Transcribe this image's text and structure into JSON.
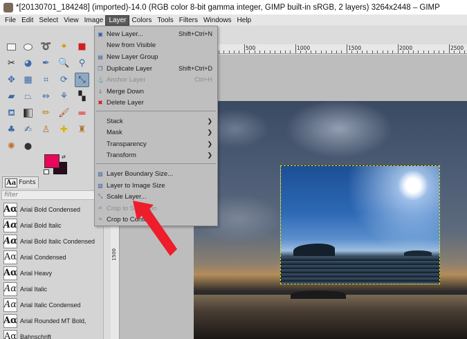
{
  "window": {
    "title": "*[20130701_184248] (imported)-14.0 (RGB color 8-bit gamma integer, GIMP built-in sRGB, 2 layers) 3264x2448 – GIMP"
  },
  "menubar": [
    {
      "label": "File"
    },
    {
      "label": "Edit"
    },
    {
      "label": "Select"
    },
    {
      "label": "View"
    },
    {
      "label": "Image"
    },
    {
      "label": "Layer",
      "active": true
    },
    {
      "label": "Colors"
    },
    {
      "label": "Tools"
    },
    {
      "label": "Filters"
    },
    {
      "label": "Windows"
    },
    {
      "label": "Help"
    }
  ],
  "layer_menu": {
    "items": [
      {
        "label": "New Layer...",
        "shortcut": "Shift+Ctrl+N",
        "icon": "new-layer-icon",
        "enabled": true
      },
      {
        "label": "New from Visible",
        "shortcut": "",
        "icon": "",
        "enabled": true
      },
      {
        "label": "New Layer Group",
        "shortcut": "",
        "icon": "layer-group-icon",
        "enabled": true
      },
      {
        "label": "Duplicate Layer",
        "shortcut": "Shift+Ctrl+D",
        "icon": "duplicate-icon",
        "enabled": true
      },
      {
        "label": "Anchor Layer",
        "shortcut": "Ctrl+H",
        "icon": "anchor-icon",
        "enabled": false
      },
      {
        "label": "Merge Down",
        "shortcut": "",
        "icon": "merge-icon",
        "enabled": true
      },
      {
        "label": "Delete Layer",
        "shortcut": "",
        "icon": "delete-icon",
        "enabled": true
      }
    ],
    "submenus": [
      {
        "label": "Stack"
      },
      {
        "label": "Mask"
      },
      {
        "label": "Transparency"
      },
      {
        "label": "Transform"
      }
    ],
    "size_items": [
      {
        "label": "Layer Boundary Size...",
        "icon": "boundary-icon",
        "enabled": true
      },
      {
        "label": "Layer to Image Size",
        "icon": "fit-image-icon",
        "enabled": true
      },
      {
        "label": "Scale Layer...",
        "icon": "scale-icon",
        "enabled": true
      },
      {
        "label": "Crop to Selection",
        "icon": "crop-icon",
        "enabled": false
      },
      {
        "label": "Crop to Content",
        "icon": "crop-content-icon",
        "enabled": true
      }
    ]
  },
  "toolbox": {
    "fonts_tab": "Fonts",
    "filter_placeholder": "filter",
    "fonts": [
      {
        "glyph": "Aα",
        "name": "Arial Bold Condensed"
      },
      {
        "glyph": "Aα",
        "name": "Arial Bold Italic"
      },
      {
        "glyph": "Aα",
        "name": "Arial Bold Italic Condensed"
      },
      {
        "glyph": "Aα",
        "name": "Arial Condensed"
      },
      {
        "glyph": "Aα",
        "name": "Arial Heavy"
      },
      {
        "glyph": "Aα",
        "name": "Arial Italic"
      },
      {
        "glyph": "Aα",
        "name": "Arial Italic Condensed"
      },
      {
        "glyph": "Aα",
        "name": "Arial Rounded MT Bold,"
      },
      {
        "glyph": "Aα",
        "name": "Bahnschrift"
      }
    ],
    "colors": {
      "foreground": "#e8075a",
      "background": "#2a0b1e"
    }
  },
  "ruler": {
    "top_labels": [
      "500",
      "1000",
      "1500",
      "2000",
      "2500"
    ],
    "left_labels": [
      "1000",
      "1500"
    ]
  },
  "accent": {
    "arrow": "#ee1d2c",
    "selection": "#e8e000"
  }
}
